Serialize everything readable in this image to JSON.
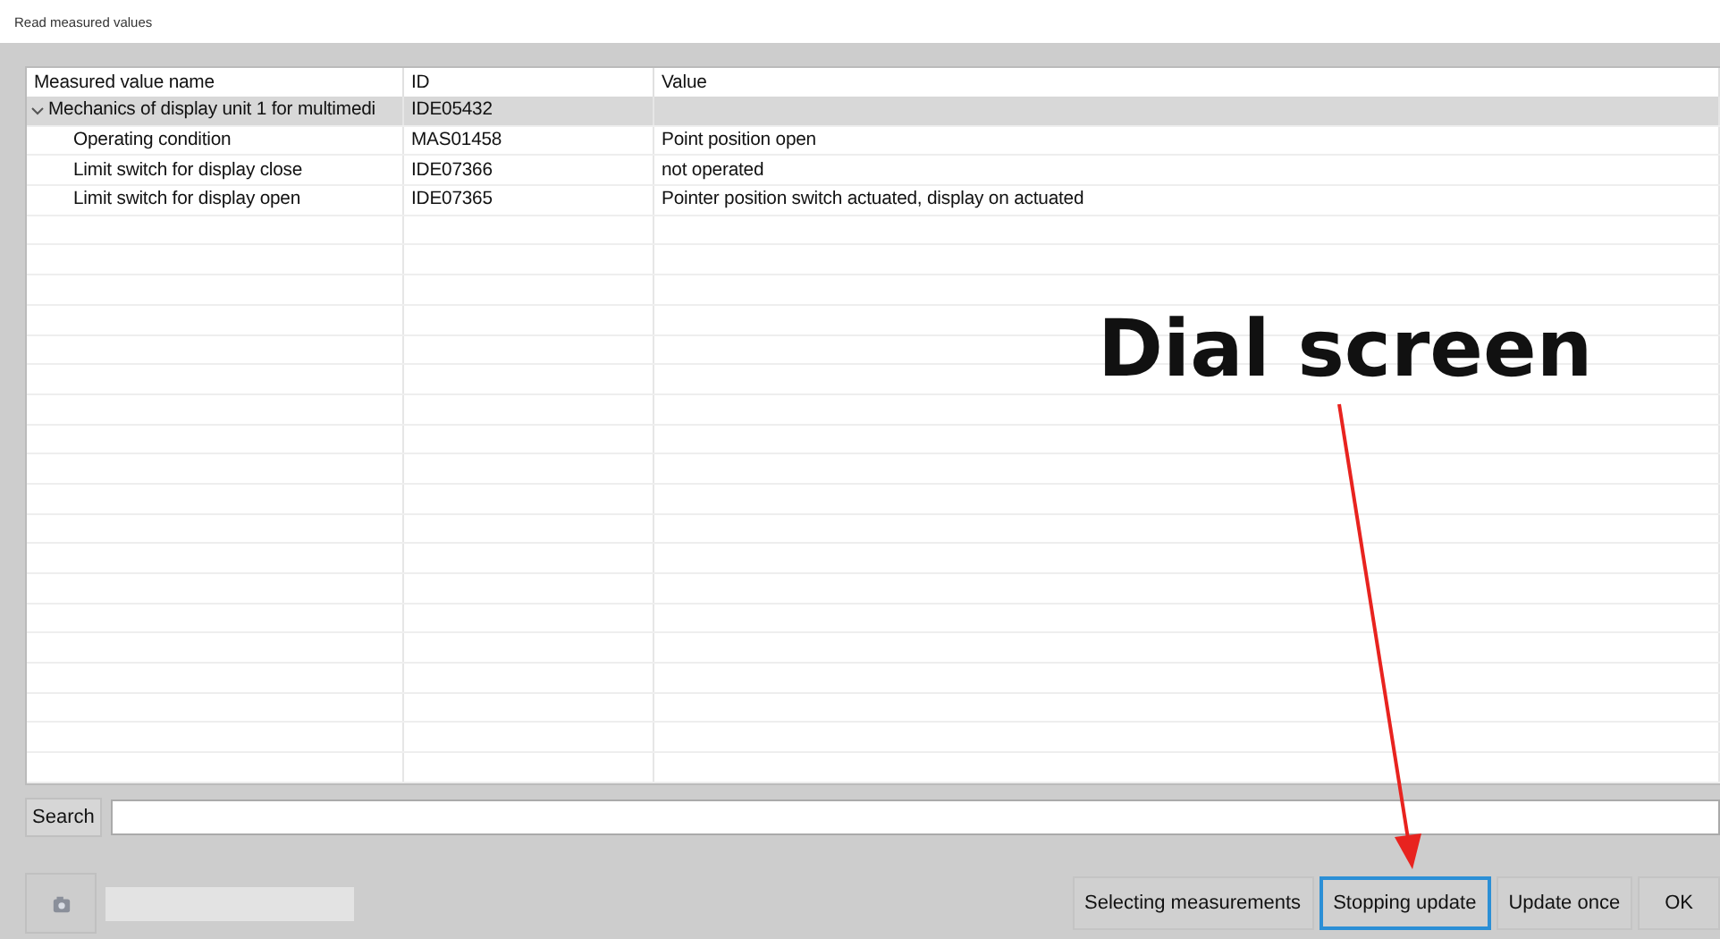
{
  "window": {
    "title": "Read measured values"
  },
  "table": {
    "columns": [
      "Measured value name",
      "ID",
      "Value"
    ],
    "groups": [
      {
        "name": "Mechanics of display unit 1 for multimedi",
        "id": "IDE05432",
        "expanded": true,
        "children": [
          {
            "name": "Operating condition",
            "id": "MAS01458",
            "value": "Point position open"
          },
          {
            "name": "Limit switch for display close",
            "id": "IDE07366",
            "value": "not operated"
          },
          {
            "name": "Limit switch for display open",
            "id": "IDE07365",
            "value": "Pointer position switch actuated, display on actuated"
          }
        ]
      }
    ]
  },
  "search": {
    "label": "Search"
  },
  "buttons": [
    {
      "label": "Selecting measurements",
      "focused": false
    },
    {
      "label": "Stopping update",
      "focused": true
    },
    {
      "label": "Update once",
      "focused": false
    },
    {
      "label": "OK",
      "focused": false
    }
  ],
  "annotation": {
    "text": "Dial screen"
  }
}
